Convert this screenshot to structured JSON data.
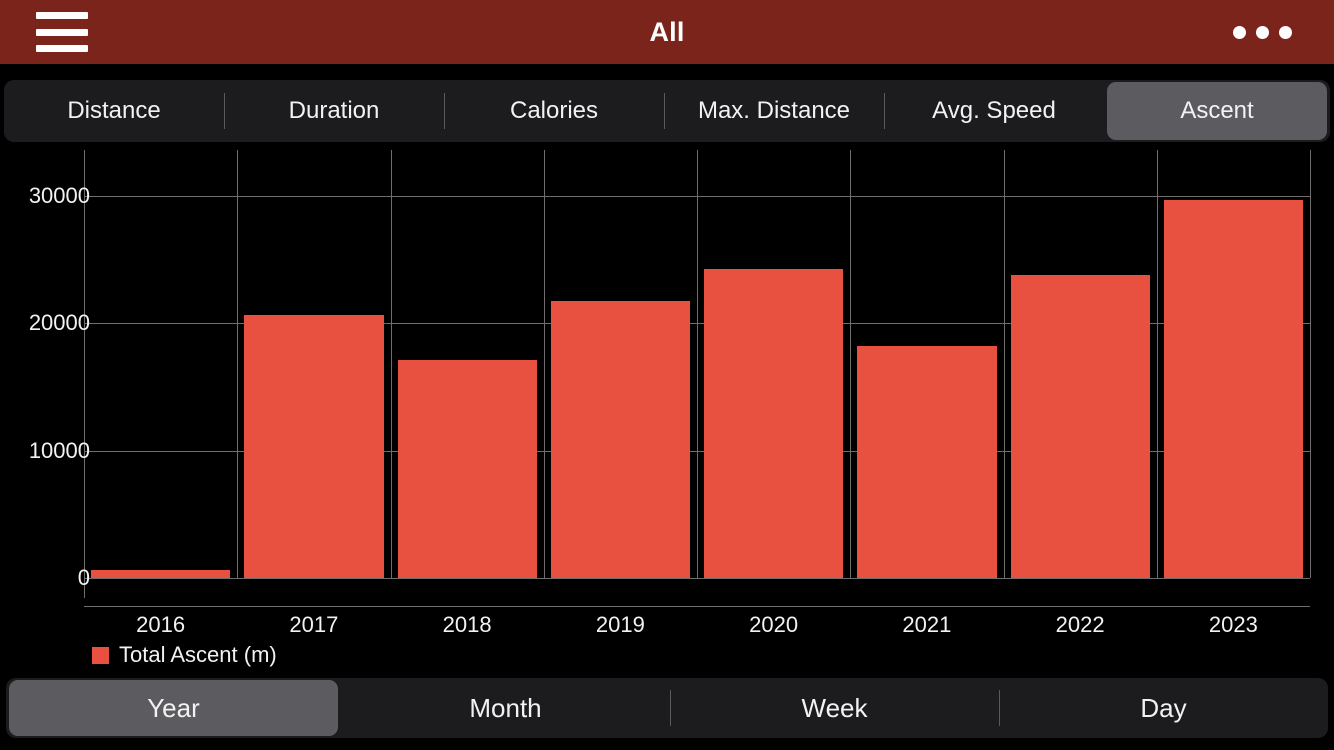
{
  "appbar": {
    "title": "All",
    "menu_icon": "hamburger-icon",
    "overflow_icon": "more-options-icon"
  },
  "metric_tabs": [
    {
      "label": "Distance",
      "selected": false
    },
    {
      "label": "Duration",
      "selected": false
    },
    {
      "label": "Calories",
      "selected": false
    },
    {
      "label": "Max. Distance",
      "selected": false
    },
    {
      "label": "Avg. Speed",
      "selected": false
    },
    {
      "label": "Ascent",
      "selected": true
    }
  ],
  "period_tabs": [
    {
      "label": "Year",
      "selected": true
    },
    {
      "label": "Month",
      "selected": false
    },
    {
      "label": "Week",
      "selected": false
    },
    {
      "label": "Day",
      "selected": false
    }
  ],
  "colors": {
    "appbar": "#7B241C",
    "bar": "#E8503F",
    "selected_pill": "#5C5C60",
    "tabbar": "#1C1C1E",
    "grid": "#6E6E6E",
    "background": "#000000"
  },
  "chart_data": {
    "type": "bar",
    "title": "",
    "xlabel": "",
    "ylabel": "",
    "categories": [
      "2016",
      "2017",
      "2018",
      "2019",
      "2020",
      "2021",
      "2022",
      "2023"
    ],
    "values": [
      600,
      20700,
      17100,
      21800,
      24300,
      18200,
      23800,
      29700
    ],
    "series": [
      {
        "name": "Total Ascent (m)",
        "values": [
          600,
          20700,
          17100,
          21800,
          24300,
          18200,
          23800,
          29700
        ]
      }
    ],
    "ylim": [
      0,
      33000
    ],
    "yticks": [
      0,
      10000,
      20000,
      30000
    ],
    "ytick_labels": [
      "0",
      "10000",
      "20000",
      "30000"
    ],
    "grid": true,
    "legend": [
      {
        "label": "Total Ascent (m)",
        "color": "#E8503F"
      }
    ],
    "legend_position": "bottom-left"
  }
}
